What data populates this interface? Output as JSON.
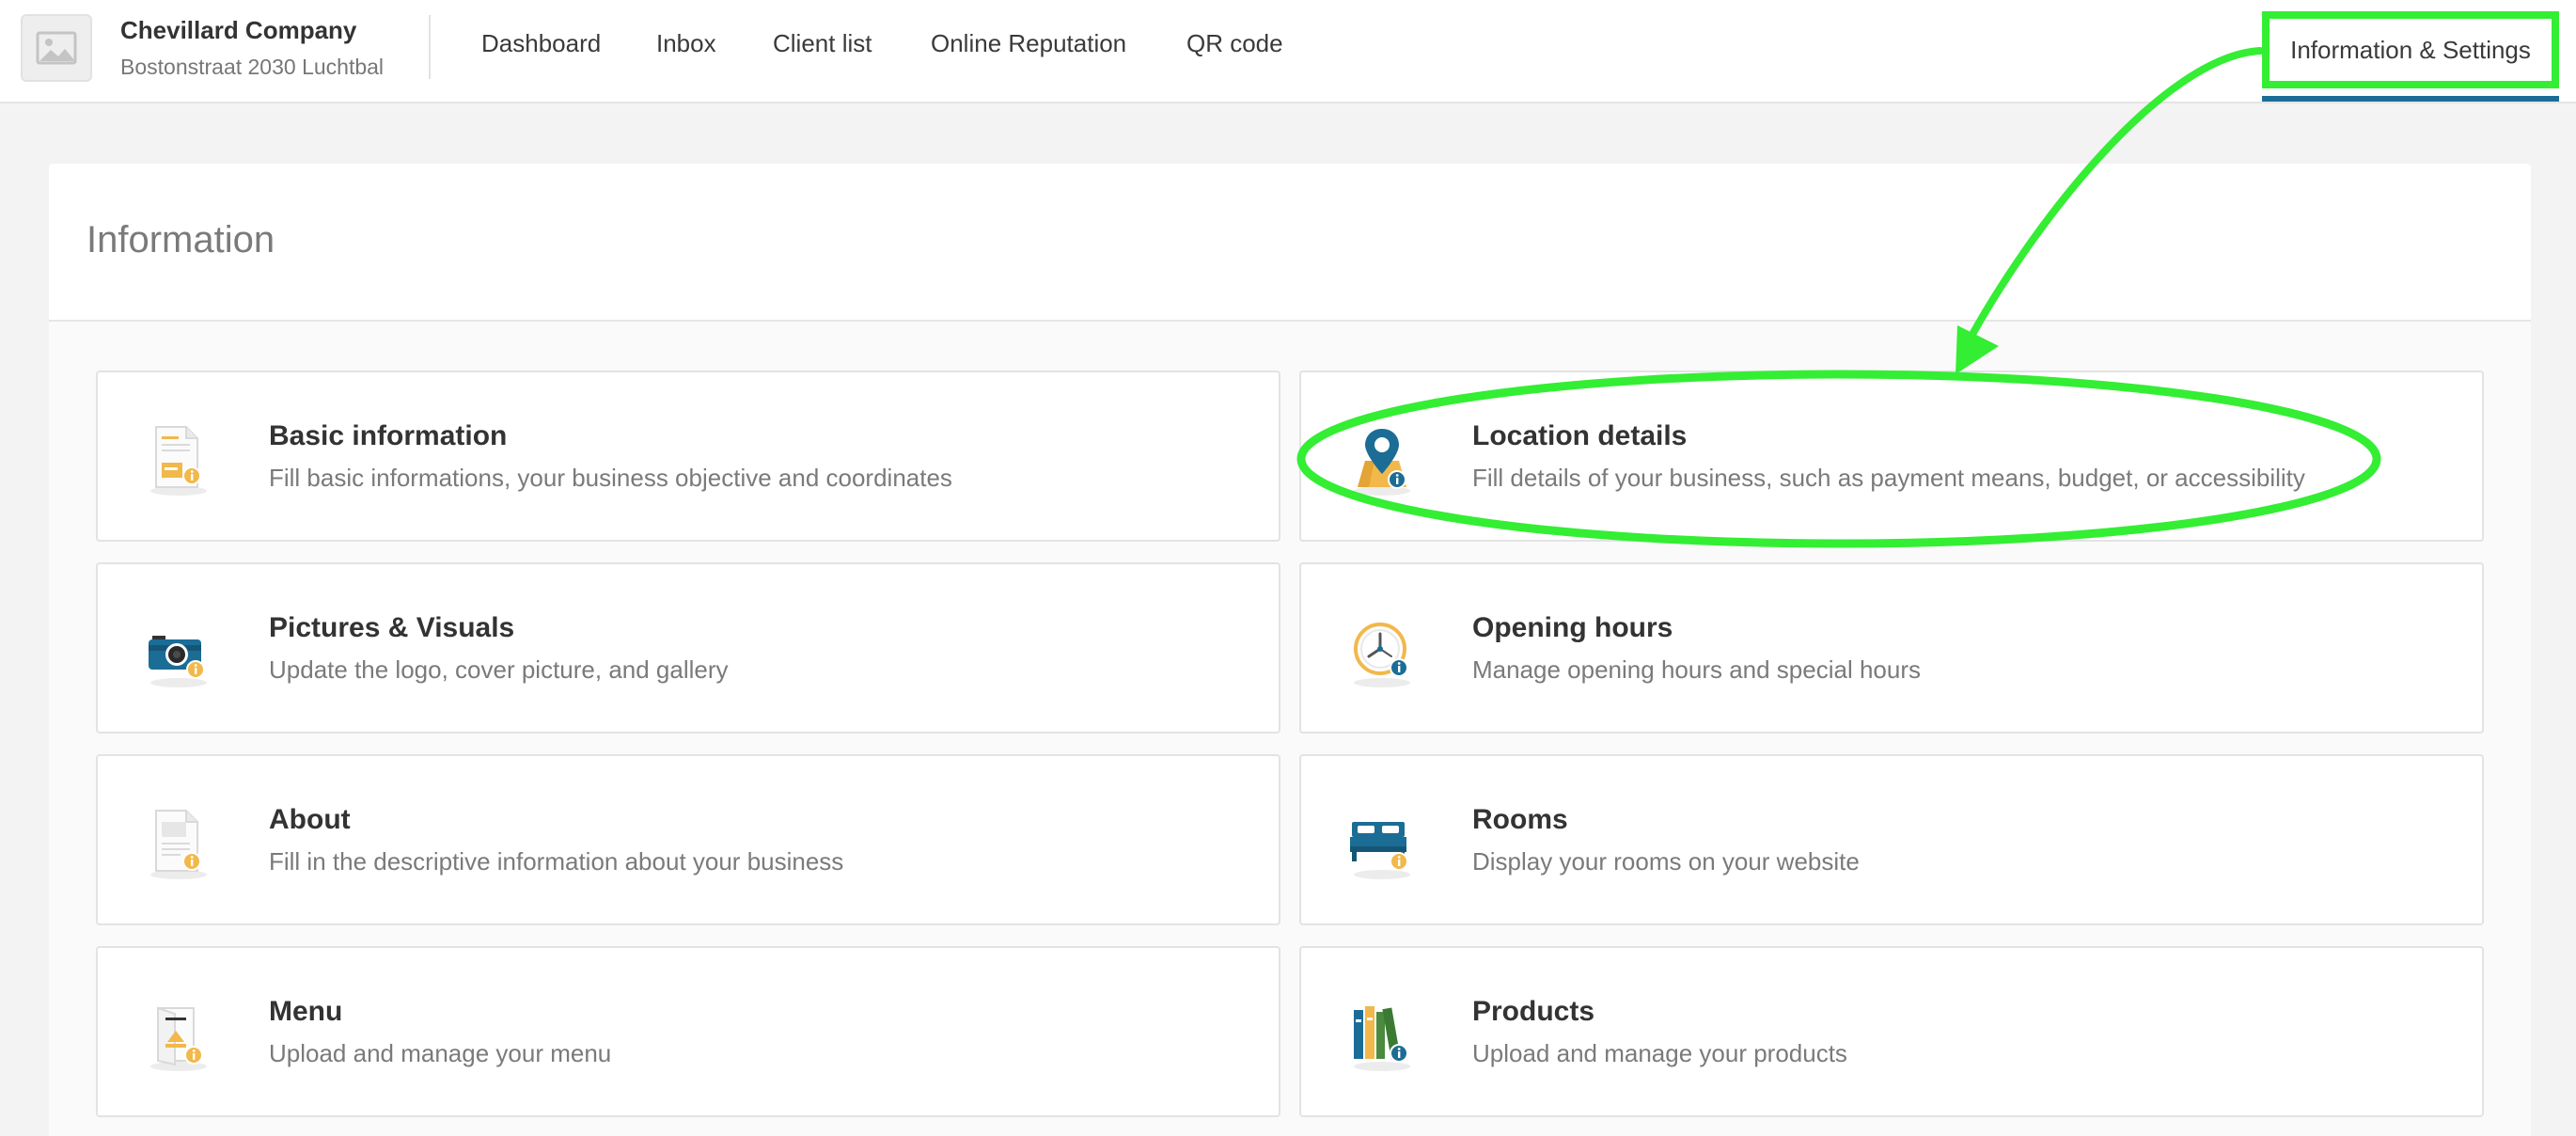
{
  "company": {
    "name": "Chevillard Company",
    "address": "Bostonstraat 2030 Luchtbal"
  },
  "nav": {
    "dashboard": "Dashboard",
    "inbox": "Inbox",
    "client_list": "Client list",
    "online_reputation": "Online Reputation",
    "qr_code": "QR code",
    "settings": "Information & Settings"
  },
  "section": {
    "title": "Information"
  },
  "tiles": [
    {
      "title": "Basic information",
      "desc": "Fill basic informations, your business objective and coordinates",
      "icon": "document-info-icon"
    },
    {
      "title": "Location details",
      "desc": "Fill details of your business, such as payment means, budget, or accessibility",
      "icon": "map-pin-info-icon"
    },
    {
      "title": "Pictures & Visuals",
      "desc": "Update the logo, cover picture, and gallery",
      "icon": "camera-info-icon"
    },
    {
      "title": "Opening hours",
      "desc": "Manage opening hours and special hours",
      "icon": "clock-info-icon"
    },
    {
      "title": "About",
      "desc": "Fill in the descriptive information about your business",
      "icon": "page-info-icon"
    },
    {
      "title": "Rooms",
      "desc": "Display your rooms on your website",
      "icon": "bed-info-icon"
    },
    {
      "title": "Menu",
      "desc": "Upload and manage your menu",
      "icon": "menu-book-info-icon"
    },
    {
      "title": "Products",
      "desc": "Upload and manage your products",
      "icon": "books-info-icon"
    }
  ],
  "colors": {
    "annotation": "#33ee33",
    "active_tab_underline": "#1b6d96",
    "icon_teal": "#1b6d96",
    "icon_yellow": "#f2b84b"
  }
}
